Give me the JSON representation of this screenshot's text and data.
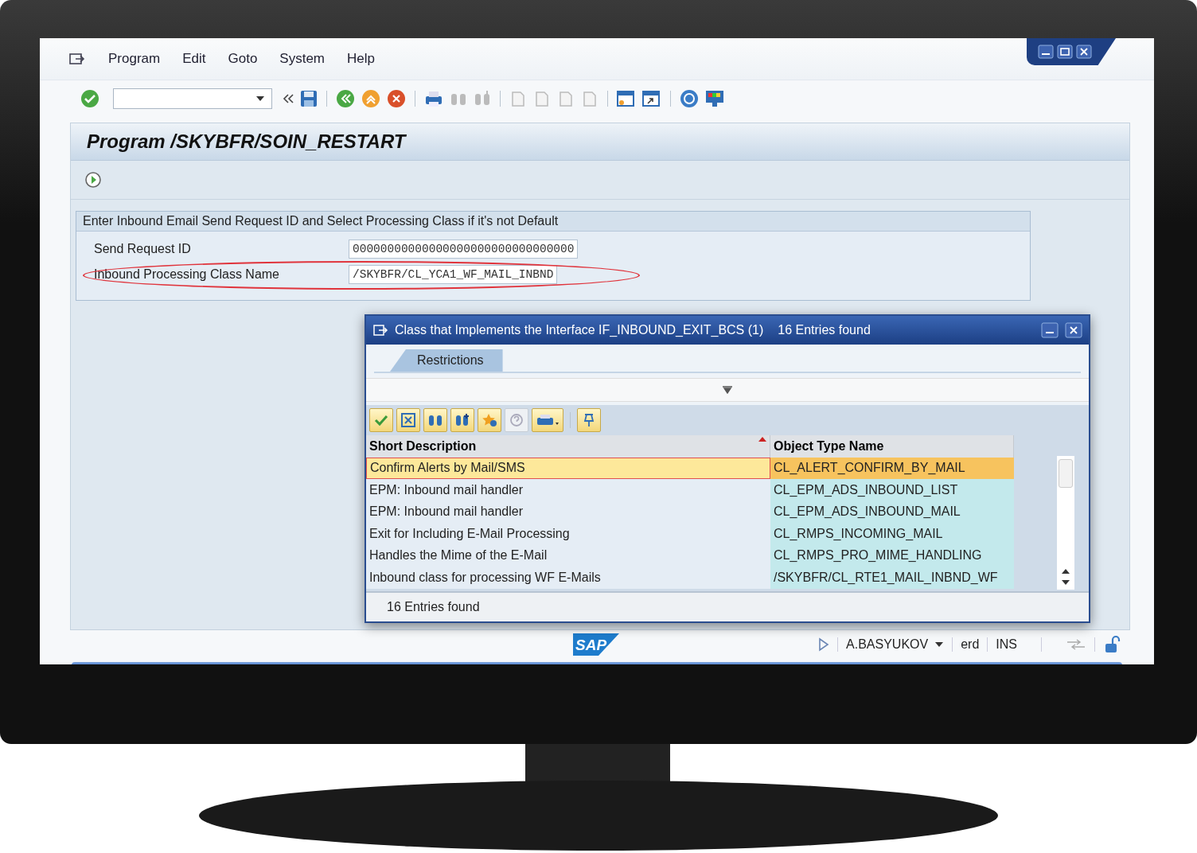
{
  "menu": [
    {
      "label": "Program"
    },
    {
      "label": "Edit"
    },
    {
      "label": "Goto"
    },
    {
      "label": "System"
    },
    {
      "label": "Help"
    }
  ],
  "title": "Program /SKYBFR/SOIN_RESTART",
  "group": {
    "title": "Enter Inbound Email Send Request ID and Select Processing Class if it's not Default",
    "fields": [
      {
        "label": "Send Request ID",
        "value": "00000000000000000000000000000000",
        "highlighted": false
      },
      {
        "label": "Inbound Processing Class Name",
        "value": "/SKYBFR/CL_YCA1_WF_MAIL_INBND",
        "highlighted": true
      }
    ]
  },
  "dialog": {
    "title": "Class that Implements the Interface IF_INBOUND_EXIT_BCS (1)",
    "count": "16 Entries found",
    "tabs": [
      {
        "label": "Restrictions",
        "selected": true
      }
    ],
    "columns": [
      "Short Description",
      "Object Type Name"
    ],
    "rows": [
      {
        "cells": [
          "Confirm Alerts by Mail/SMS",
          "CL_ALERT_CONFIRM_BY_MAIL"
        ],
        "selected": true
      },
      {
        "cells": [
          "EPM: Inbound mail handler",
          "CL_EPM_ADS_INBOUND_LIST"
        ],
        "selected": false
      },
      {
        "cells": [
          "EPM: Inbound mail handler",
          "CL_EPM_ADS_INBOUND_MAIL"
        ],
        "selected": false
      },
      {
        "cells": [
          "Exit for Including E-Mail Processing",
          "CL_RMPS_INCOMING_MAIL"
        ],
        "selected": false
      },
      {
        "cells": [
          "Handles the Mime of the E-Mail",
          "CL_RMPS_PRO_MIME_HANDLING"
        ],
        "selected": false
      },
      {
        "cells": [
          "Inbound class for processing WF E-Mails",
          "/SKYBFR/CL_RTE1_MAIL_INBND_WF"
        ],
        "selected": false
      }
    ],
    "status": "16 Entries found"
  },
  "status_bar": {
    "logo": "SAP",
    "user": "A.BASYUKOV",
    "client": "erd",
    "mode": "INS"
  }
}
